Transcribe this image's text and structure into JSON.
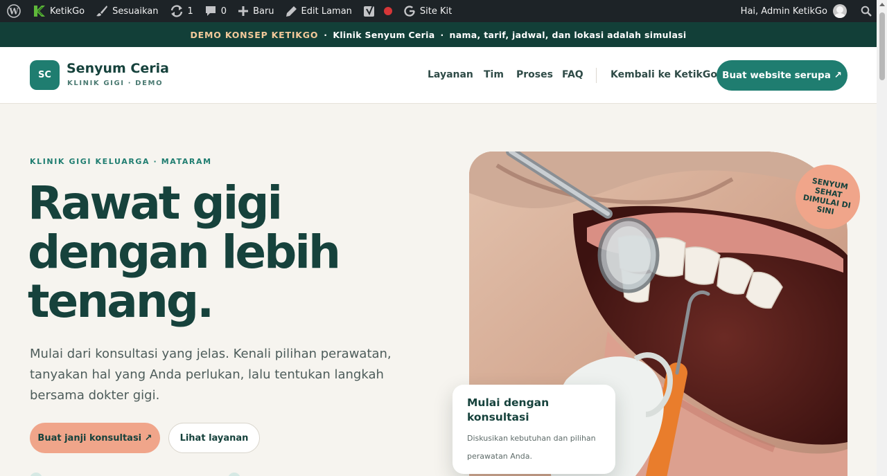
{
  "admin_bar": {
    "site_name": "KetikGo",
    "customize": "Sesuaikan",
    "updates_count": "1",
    "comments_count": "0",
    "new_label": "Baru",
    "edit_page": "Edit Laman",
    "site_kit": "Site Kit",
    "greeting": "Hai, Admin KetikGo"
  },
  "demo_bar": {
    "accent": "DEMO KONSEP KETIKGO",
    "separator": "·",
    "clinic": "Klinik Senyum Ceria",
    "note": "nama, tarif, jadwal, dan lokasi adalah simulasi"
  },
  "header": {
    "logo_initials": "SC",
    "brand_name": "Senyum Ceria",
    "brand_sub": "KLINIK GIGI · DEMO",
    "nav": [
      "Layanan",
      "Tim",
      "Proses",
      "FAQ"
    ],
    "back_link": "Kembali ke KetikGo",
    "cta": "Buat website serupa ↗"
  },
  "hero": {
    "eyebrow": "KLINIK GIGI KELUARGA · MATARAM",
    "headline": [
      "Rawat gigi",
      "dengan lebih",
      "tenang."
    ],
    "lead": "Mulai dari konsultasi yang jelas. Kenali pilihan perawatan, tanyakan hal yang Anda perlukan, lalu tentukan langkah bersama dokter gigi.",
    "primary_button": "Buat janji konsultasi ↗",
    "secondary_button": "Lihat layanan",
    "badge": "SENYUM SEHAT DIMULAI DI SINI",
    "card_title": "Mulai dengan konsultasi",
    "card_body": "Diskusikan kebutuhan dan pilihan perawatan Anda."
  },
  "colors": {
    "admin_bar": "#1d2327",
    "demo_bar": "#123f38",
    "brand_teal": "#1f7d70",
    "peach": "#f0a58a",
    "heading": "#16423c",
    "page_bg": "#f6f4ef"
  }
}
